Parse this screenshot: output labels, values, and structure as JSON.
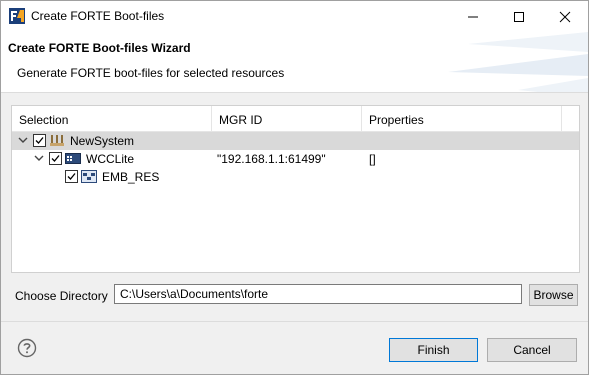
{
  "window": {
    "title": "Create FORTE Boot-files"
  },
  "wizard": {
    "title": "Create FORTE Boot-files Wizard",
    "description": "Generate FORTE boot-files for selected resources"
  },
  "tree": {
    "columns": [
      "Selection",
      "MGR ID",
      "Properties"
    ],
    "rows": [
      {
        "label": "NewSystem",
        "mgr_id": "",
        "properties": "",
        "checked": true,
        "expanded": true,
        "icon": "system-icon"
      },
      {
        "label": "WCCLite",
        "mgr_id": "\"192.168.1.1:61499\"",
        "properties": "[]",
        "checked": true,
        "expanded": true,
        "icon": "device-icon"
      },
      {
        "label": "EMB_RES",
        "mgr_id": "",
        "properties": "",
        "checked": true,
        "expanded": false,
        "icon": "resource-icon"
      }
    ]
  },
  "directory": {
    "label": "Choose Directory",
    "value": "C:\\Users\\a\\Documents\\forte",
    "browse_label": "Browse"
  },
  "footer": {
    "finish_label": "Finish",
    "cancel_label": "Cancel"
  }
}
